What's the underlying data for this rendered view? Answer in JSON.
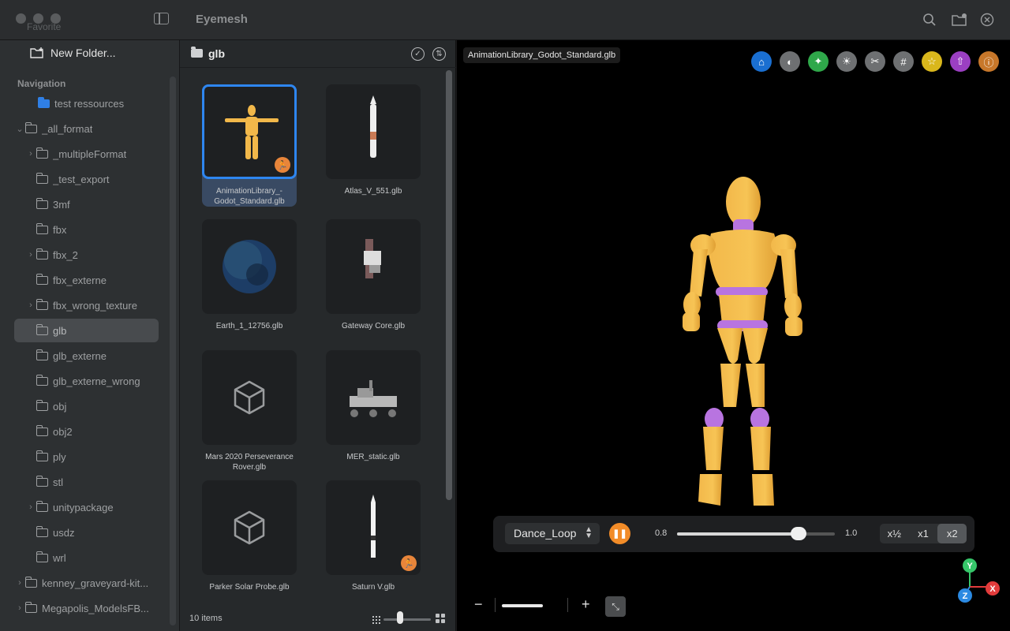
{
  "window": {
    "title": "Eyemesh"
  },
  "sidebar": {
    "faded_label": "Favorite",
    "new_folder_label": "New Folder...",
    "nav_heading": "Navigation",
    "items": [
      {
        "label": "test ressources",
        "chevron": "",
        "icon": "blue-folder-icon"
      },
      {
        "label": "_all_format",
        "chevron": "⌄",
        "icon": "folder-icon"
      },
      {
        "label": "_multipleFormat",
        "chevron": "›",
        "icon": "folder-icon"
      },
      {
        "label": "_test_export",
        "chevron": "",
        "icon": "folder-icon"
      },
      {
        "label": "3mf",
        "chevron": "",
        "icon": "folder-icon"
      },
      {
        "label": "fbx",
        "chevron": "",
        "icon": "folder-icon"
      },
      {
        "label": "fbx_2",
        "chevron": "›",
        "icon": "folder-icon"
      },
      {
        "label": "fbx_externe",
        "chevron": "",
        "icon": "folder-icon"
      },
      {
        "label": "fbx_wrong_texture",
        "chevron": "›",
        "icon": "folder-icon"
      },
      {
        "label": "glb",
        "chevron": "",
        "icon": "folder-icon",
        "selected": true
      },
      {
        "label": "glb_externe",
        "chevron": "",
        "icon": "folder-icon"
      },
      {
        "label": "glb_externe_wrong",
        "chevron": "",
        "icon": "folder-icon"
      },
      {
        "label": "obj",
        "chevron": "",
        "icon": "folder-icon"
      },
      {
        "label": "obj2",
        "chevron": "",
        "icon": "folder-icon"
      },
      {
        "label": "ply",
        "chevron": "",
        "icon": "folder-icon"
      },
      {
        "label": "stl",
        "chevron": "",
        "icon": "folder-icon"
      },
      {
        "label": "unitypackage",
        "chevron": "›",
        "icon": "folder-icon"
      },
      {
        "label": "usdz",
        "chevron": "",
        "icon": "folder-icon"
      },
      {
        "label": "wrl",
        "chevron": "",
        "icon": "folder-icon"
      },
      {
        "label": "kenney_graveyard-kit...",
        "chevron": "›",
        "icon": "folder-icon"
      },
      {
        "label": "Megapolis_ModelsFB...",
        "chevron": "›",
        "icon": "folder-icon"
      }
    ]
  },
  "browser": {
    "folder_title": "glb",
    "items_count": "10 items",
    "files": [
      {
        "name": "AnimationLibrary_-Godot_Standard.glb",
        "line1": "AnimationLibrary_-",
        "line2": "Godot_Standard.glb",
        "animated": true,
        "selected": true,
        "preview": "mannequin"
      },
      {
        "name": "Atlas_V_551.glb",
        "line1": "Atlas_V_551.glb",
        "line2": "",
        "animated": false,
        "preview": "rocket"
      },
      {
        "name": "Earth_1_12756.glb",
        "line1": "Earth_1_12756.glb",
        "line2": "",
        "animated": false,
        "preview": "earth"
      },
      {
        "name": "Gateway Core.glb",
        "line1": "Gateway Core.glb",
        "line2": "",
        "animated": false,
        "preview": "station"
      },
      {
        "name": "Mars 2020 Perseverance Rover.glb",
        "line1": "Mars 2020 Perseverance",
        "line2": "Rover.glb",
        "animated": false,
        "preview": "placeholder"
      },
      {
        "name": "MER_static.glb",
        "line1": "MER_static.glb",
        "line2": "",
        "animated": false,
        "preview": "rover"
      },
      {
        "name": "Parker Solar Probe.glb",
        "line1": "Parker Solar Probe.glb",
        "line2": "",
        "animated": false,
        "preview": "placeholder"
      },
      {
        "name": "Saturn V.glb",
        "line1": "Saturn V.glb",
        "line2": "",
        "animated": true,
        "preview": "saturn"
      }
    ]
  },
  "viewer": {
    "file_tag": "AnimationLibrary_Godot_Standard.glb",
    "tools": [
      {
        "name": "home-icon",
        "color": "#1a6fd1",
        "glyph": "⌂"
      },
      {
        "name": "contrast-icon",
        "color": "#6e7072",
        "glyph": "◐"
      },
      {
        "name": "pin-icon",
        "color": "#2fa84a",
        "glyph": "✦"
      },
      {
        "name": "sun-icon",
        "color": "#6e7072",
        "glyph": "☀"
      },
      {
        "name": "scissors-icon",
        "color": "#6e7072",
        "glyph": "✂"
      },
      {
        "name": "grid-icon",
        "color": "#6e7072",
        "glyph": "#"
      },
      {
        "name": "star-icon",
        "color": "#d9b71c",
        "glyph": "☆"
      },
      {
        "name": "share-icon",
        "color": "#9b3fc2",
        "glyph": "⇧"
      },
      {
        "name": "info-icon",
        "color": "#c7772a",
        "glyph": "ⓘ"
      }
    ],
    "animation": {
      "selected": "Dance_Loop",
      "speed_min": "0.8",
      "speed_max": "1.0",
      "speed_fraction": 0.77,
      "rates": [
        "x½",
        "x1",
        "x2"
      ],
      "active_rate": "x2"
    },
    "zoom": {
      "minus": "−",
      "plus": "+"
    },
    "axis": {
      "y": "Y",
      "x": "X",
      "z": "Z"
    }
  }
}
